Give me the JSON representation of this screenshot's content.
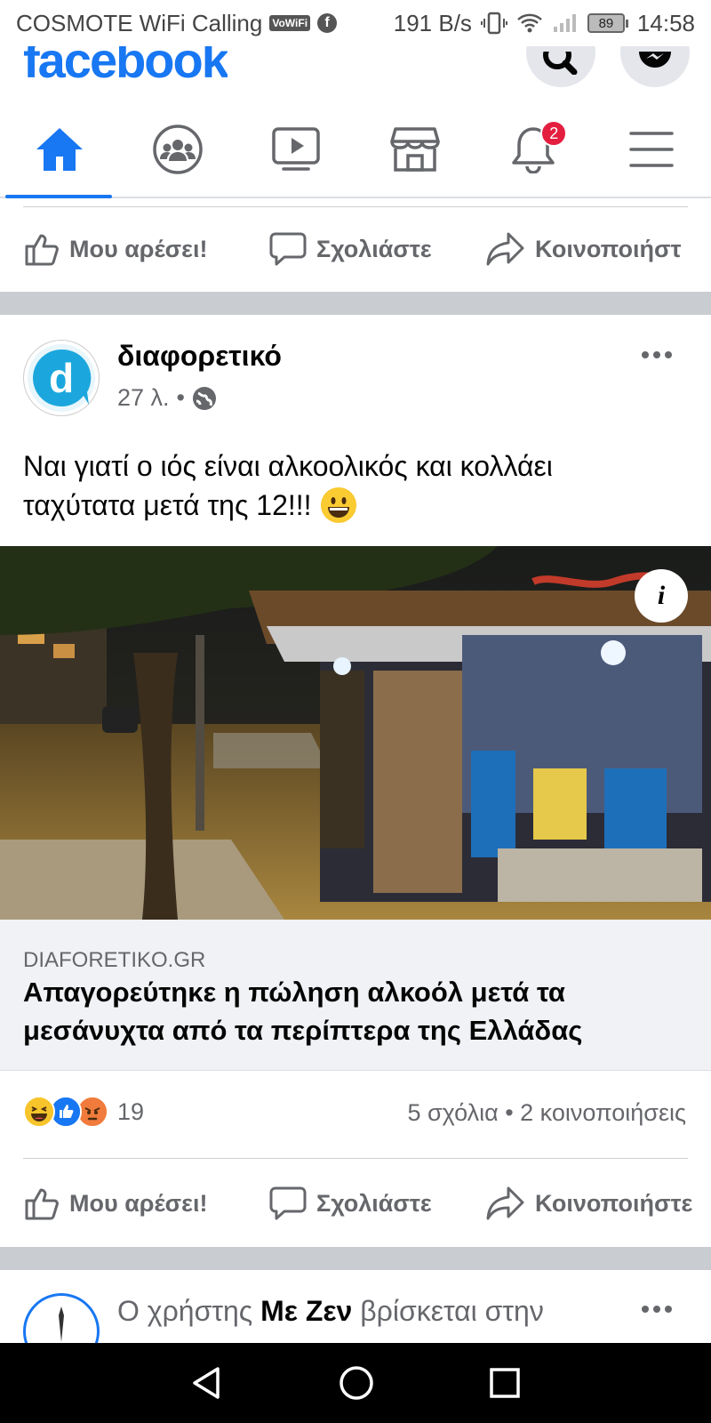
{
  "status_bar": {
    "carrier": "COSMOTE WiFi Calling",
    "vowifi": "VoWiFi",
    "fb_icon": "f",
    "speed": "191 B/s",
    "battery": "89",
    "time": "14:58"
  },
  "header": {
    "logo": "facebook"
  },
  "tabs": {
    "icons": [
      "home-icon",
      "groups-icon",
      "watch-icon",
      "marketplace-icon",
      "notifications-icon",
      "menu-icon"
    ],
    "notification_count": "2"
  },
  "actions": {
    "like": "Μου αρέσει!",
    "comment": "Σχολιάστε",
    "share_truncated": "Κοινοποιήστ",
    "share": "Κοινοποιήστε"
  },
  "post": {
    "avatar_letter": "d",
    "page_name": "διαφορετικό",
    "time": "27 λ.",
    "dot": "•",
    "text_line1": "Ναι γιατί ο ιός είναι αλκοολικός και κολλάει",
    "text_line2": "ταχύτατα μετά της 12!!!",
    "emoji": "😀",
    "info_label": "i",
    "link_domain": "DIAFORETIKO.GR",
    "link_title_line1": "Απαγορεύτηκε η πώληση αλκοόλ μετά τα",
    "link_title_line2": "μεσάνυχτα από τα περίπτερα της Ελλάδας",
    "reaction_count": "19",
    "comments_shares": "5 σχόλια • 2 κοινοποιήσεις"
  },
  "next_post": {
    "prefix": "Ο χρήστης ",
    "name": "Με Ζεν",
    "suffix": " βρίσκεται στην"
  },
  "colors": {
    "brand": "#1877f2",
    "badge": "#e41e3f",
    "secondary_text": "#65676b",
    "separator": "#c9ccd1"
  }
}
